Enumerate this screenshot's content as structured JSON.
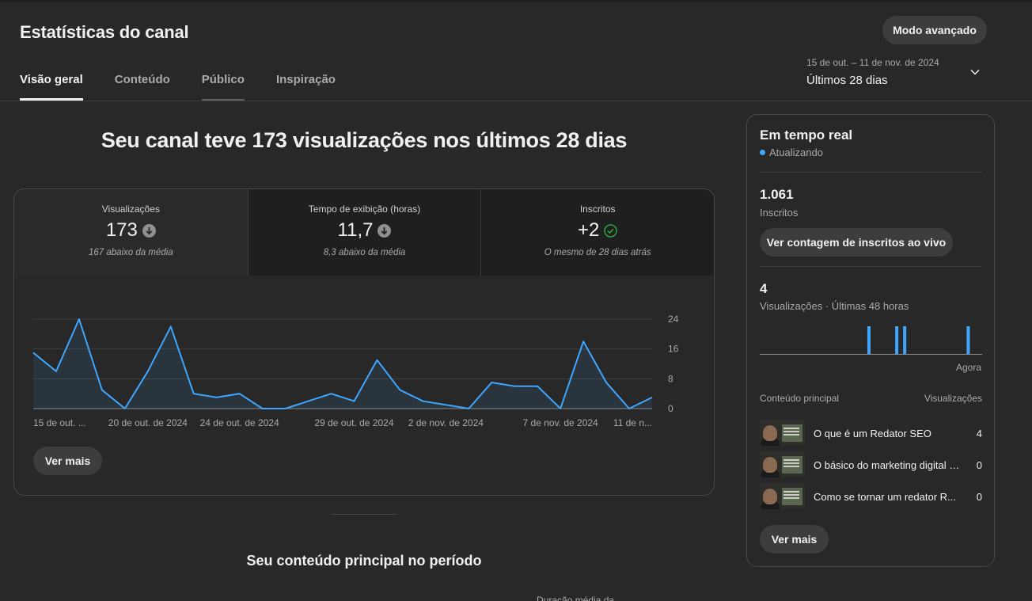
{
  "header": {
    "title": "Estatísticas do canal",
    "advanced_mode": "Modo avançado",
    "tabs": [
      {
        "label": "Visão geral",
        "active": true
      },
      {
        "label": "Conteúdo",
        "active": false
      },
      {
        "label": "Público",
        "active": false
      },
      {
        "label": "Inspiração",
        "active": false
      }
    ],
    "date_range": {
      "range": "15 de out. – 11 de nov. de 2024",
      "period": "Últimos 28 dias",
      "icon": "chevron-down-icon"
    }
  },
  "overview": {
    "headline": "Seu canal teve 173 visualizações nos últimos 28 dias",
    "metrics": [
      {
        "label": "Visualizações",
        "value": "173",
        "sub": "167 abaixo da média",
        "icon": "arrow-down-circle-icon"
      },
      {
        "label": "Tempo de exibição (horas)",
        "value": "11,7",
        "sub": "8,3 abaixo da média",
        "icon": "arrow-down-circle-icon"
      },
      {
        "label": "Inscritos",
        "value": "+2",
        "sub": "O mesmo de 28 dias atrás",
        "icon": "check-circle-icon"
      }
    ],
    "see_more": "Ver mais"
  },
  "chart_data": {
    "type": "area",
    "x": [
      "15 de out.",
      "16 de out.",
      "17 de out.",
      "18 de out.",
      "19 de out.",
      "20 de out.",
      "21 de out.",
      "22 de out.",
      "23 de out.",
      "24 de out.",
      "25 de out.",
      "26 de out.",
      "27 de out.",
      "28 de out.",
      "29 de out.",
      "30 de out.",
      "31 de out.",
      "1 de nov.",
      "2 de nov.",
      "3 de nov.",
      "4 de nov.",
      "5 de nov.",
      "6 de nov.",
      "7 de nov.",
      "8 de nov.",
      "9 de nov.",
      "10 de nov.",
      "11 de nov."
    ],
    "series": [
      {
        "values": [
          15,
          10,
          24,
          5,
          0,
          10,
          22,
          4,
          3,
          4,
          0,
          0,
          2,
          4,
          2,
          13,
          5,
          2,
          1,
          0,
          7,
          6,
          6,
          0,
          18,
          7,
          0,
          3
        ]
      }
    ],
    "x_tick_labels": [
      "15 de out. ...",
      "20 de out. de 2024",
      "24 de out. de 2024",
      "29 de out. de 2024",
      "2 de nov. de 2024",
      "7 de nov. de 2024",
      "11 de n..."
    ],
    "x_tick_indices": [
      0,
      5,
      9,
      14,
      18,
      23,
      27
    ],
    "y_ticks": [
      "24",
      "16",
      "8",
      "0"
    ],
    "ylim": [
      0,
      24
    ],
    "grid": true,
    "color": "#3ea6ff"
  },
  "content_section": {
    "title": "Seu conteúdo principal no período",
    "cutoff_label": "Duração média da"
  },
  "realtime": {
    "title": "Em tempo real",
    "status": "Atualizando",
    "subscribers_value": "1.061",
    "subscribers_label": "Inscritos",
    "live_button": "Ver contagem de inscritos ao vivo",
    "views_value": "4",
    "views_label": "Visualizações · Últimas 48 horas",
    "now_label": "Agora",
    "bars": [
      0,
      0,
      0,
      0,
      0,
      0,
      0,
      0,
      0,
      0,
      0,
      0,
      0,
      0,
      0,
      0,
      0,
      0,
      0,
      0,
      0,
      0,
      0,
      0,
      0,
      0,
      0,
      1,
      0,
      0,
      0,
      0,
      0,
      0,
      1,
      0,
      1,
      0,
      0,
      0,
      0,
      0,
      0,
      0,
      0,
      0,
      0,
      0,
      0,
      0,
      0,
      0,
      1,
      0,
      0,
      0
    ],
    "table_head": {
      "left": "Conteúdo principal",
      "right": "Visualizações"
    },
    "top_content": [
      {
        "title": "O que é um Redator SEO",
        "views": "4"
      },
      {
        "title": "O básico do marketing digital para redatores",
        "views": "0"
      },
      {
        "title": "Como se tornar um redator R...",
        "views": "0"
      }
    ],
    "see_more": "Ver mais"
  }
}
